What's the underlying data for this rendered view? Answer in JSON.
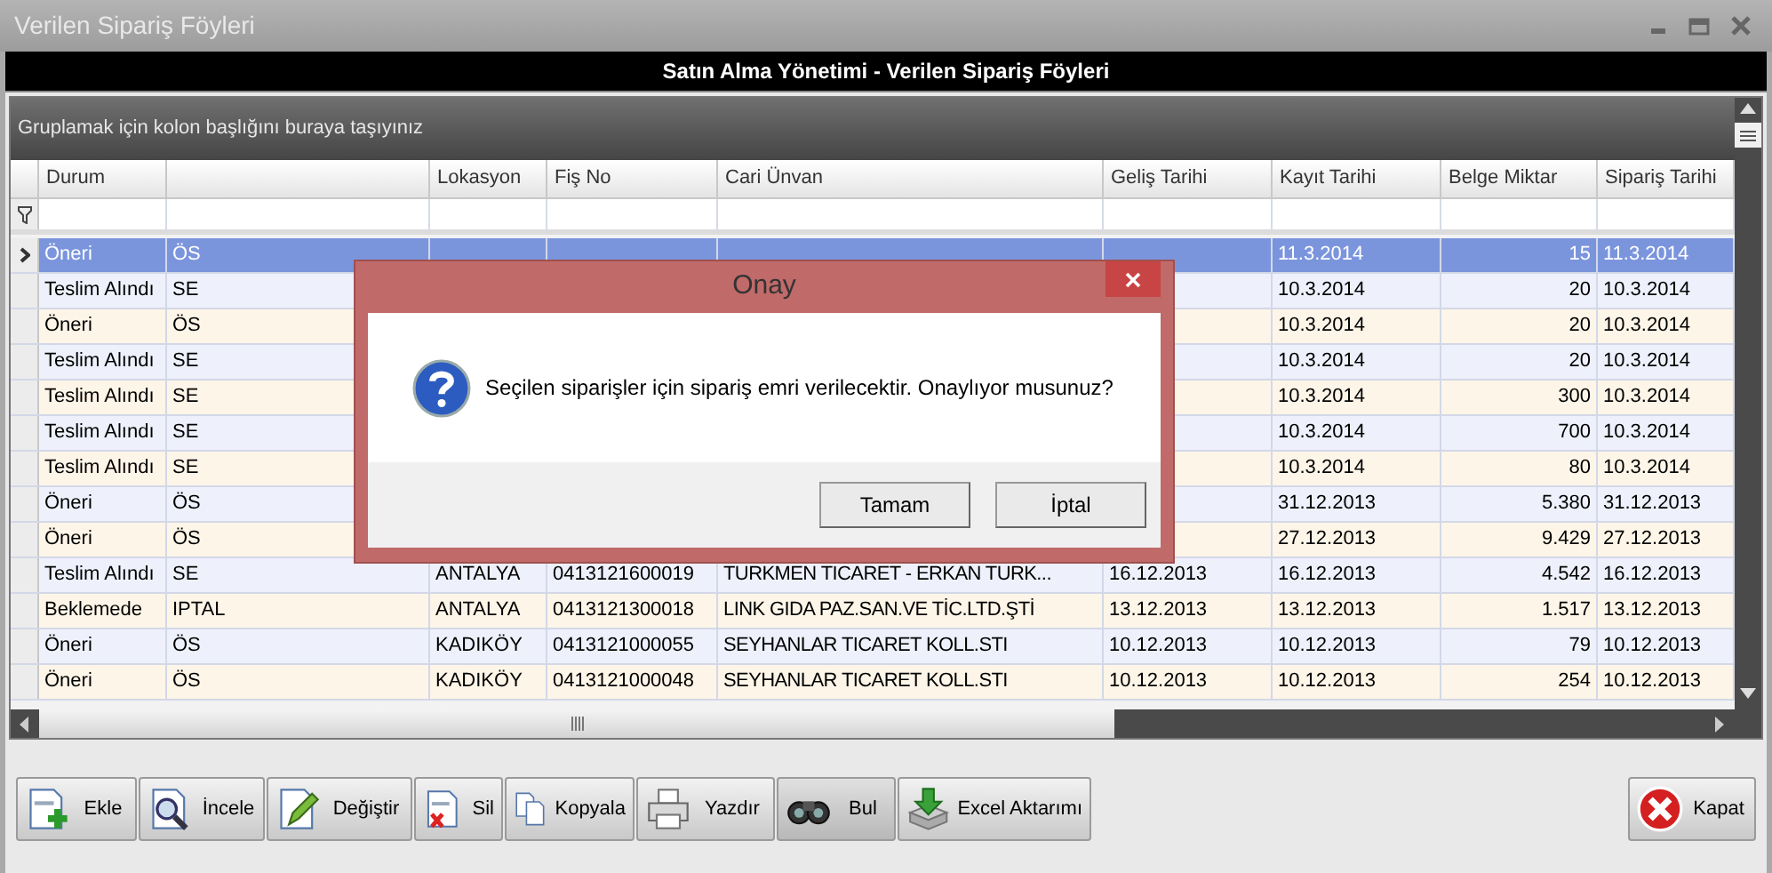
{
  "window": {
    "title": "Verilen Sipariş Föyleri"
  },
  "header": "Satın Alma Yönetimi - Verilen Sipariş Föyleri",
  "group_panel": {
    "hint": "Gruplamak için kolon başlığını buraya taşıyınız"
  },
  "table": {
    "columns": [
      "Durum",
      null,
      "Lokasyon",
      "Fiş No",
      "Cari Ünvan",
      "Geliş Tarihi",
      "Kayıt Tarihi",
      "Belge Miktar",
      "Sipariş Tarihi"
    ],
    "rows": [
      {
        "selected": true,
        "cells": [
          "Öneri",
          "ÖS",
          null,
          null,
          null,
          null,
          "11.3.2014",
          "15",
          "11.3.2014"
        ]
      },
      {
        "selected": false,
        "cells": [
          "Teslim Alındı",
          "SE",
          null,
          null,
          null,
          null,
          "10.3.2014",
          "20",
          "10.3.2014"
        ]
      },
      {
        "selected": false,
        "cells": [
          "Öneri",
          "ÖS",
          null,
          null,
          null,
          null,
          "10.3.2014",
          "20",
          "10.3.2014"
        ]
      },
      {
        "selected": false,
        "cells": [
          "Teslim Alındı",
          "SE",
          null,
          null,
          null,
          null,
          "10.3.2014",
          "20",
          "10.3.2014"
        ]
      },
      {
        "selected": false,
        "cells": [
          "Teslim Alındı",
          "SE",
          null,
          null,
          null,
          null,
          "10.3.2014",
          "300",
          "10.3.2014"
        ]
      },
      {
        "selected": false,
        "cells": [
          "Teslim Alındı",
          "SE",
          null,
          null,
          null,
          null,
          "10.3.2014",
          "700",
          "10.3.2014"
        ]
      },
      {
        "selected": false,
        "cells": [
          "Teslim Alındı",
          "SE",
          null,
          null,
          null,
          null,
          "10.3.2014",
          "80",
          "10.3.2014"
        ]
      },
      {
        "selected": false,
        "cells": [
          "Öneri",
          "ÖS",
          null,
          null,
          null,
          null,
          "31.12.2013",
          "5.380",
          "31.12.2013"
        ]
      },
      {
        "selected": false,
        "cells": [
          "Öneri",
          "ÖS",
          null,
          null,
          null,
          null,
          "27.12.2013",
          "9.429",
          "27.12.2013"
        ]
      },
      {
        "selected": false,
        "cells": [
          "Teslim Alındı",
          "SE",
          "ANTALYA",
          "0413121600019",
          "TURKMEN TICARET - ERKAN TURK...",
          "16.12.2013",
          "16.12.2013",
          "4.542",
          "16.12.2013"
        ]
      },
      {
        "selected": false,
        "cells": [
          "Beklemede",
          "IPTAL",
          "ANTALYA",
          "0413121300018",
          "LINK GIDA PAZ.SAN.VE TİC.LTD.ŞTİ",
          "13.12.2013",
          "13.12.2013",
          "1.517",
          "13.12.2013"
        ]
      },
      {
        "selected": false,
        "cells": [
          "Öneri",
          "ÖS",
          "KADIKÖY",
          "0413121000055",
          "SEYHANLAR TICARET KOLL.STI",
          "10.12.2013",
          "10.12.2013",
          "79",
          "10.12.2013"
        ]
      },
      {
        "selected": false,
        "cells": [
          "Öneri",
          "ÖS",
          "KADIKÖY",
          "0413121000048",
          "SEYHANLAR TICARET KOLL.STI",
          "10.12.2013",
          "10.12.2013",
          "254",
          "10.12.2013"
        ]
      }
    ]
  },
  "toolbar": [
    {
      "kind": "add",
      "label": "Ekle"
    },
    {
      "kind": "inspect",
      "label": "İncele"
    },
    {
      "kind": "edit",
      "label": "Değiştir"
    },
    {
      "kind": "delete",
      "label": "Sil"
    },
    {
      "kind": "copy",
      "label": "Kopyala"
    },
    {
      "kind": "print",
      "label": "Yazdır"
    },
    {
      "kind": "find",
      "label": "Bul"
    },
    {
      "kind": "export",
      "label": "Excel Aktarımı"
    },
    {
      "kind": "close",
      "label": "Kapat"
    }
  ],
  "dialog": {
    "title": "Onay",
    "message": "Seçilen siparişler için sipariş emri verilecektir. Onaylıyor musunuz?",
    "buttons": [
      "Tamam",
      "İptal"
    ]
  }
}
